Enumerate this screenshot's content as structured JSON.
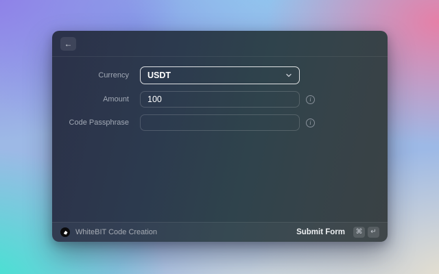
{
  "window": {
    "header": {
      "back_label": "←"
    },
    "form": {
      "fields": [
        {
          "label": "Currency",
          "value": "USDT",
          "type": "dropdown"
        },
        {
          "label": "Amount",
          "value": "100",
          "type": "text",
          "info": "i"
        },
        {
          "label": "Code Passphrase",
          "value": "",
          "type": "text",
          "info": "i"
        }
      ]
    },
    "footer": {
      "app_title": "WhiteBIT Code Creation",
      "action_label": "Submit Form",
      "shortcut_keys": {
        "cmd": "⌘",
        "enter": "↵"
      }
    }
  },
  "colors": {
    "window_left": "#2b3149",
    "window_mid": "#2f434c",
    "window_right": "#3a4144",
    "focus_border": "#ffffff",
    "label_text": "#a2a9b5",
    "bg_purple": "#8d7ae8",
    "bg_blue": "#7e96e9",
    "bg_lightblue": "#8ec8f0",
    "bg_pink": "#e97da4",
    "bg_teal": "#3ee6d0",
    "bg_cream": "#eee4cd"
  }
}
